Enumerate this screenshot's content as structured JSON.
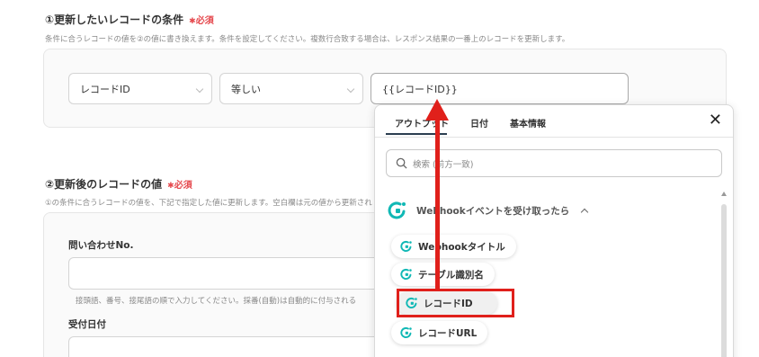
{
  "section1": {
    "title": "①更新したいレコードの条件",
    "required": "必須",
    "description": "条件に合うレコードの値を②の値に書き換えます。条件を設定してください。複数行合致する場合は、レスポンス結果の一番上のレコードを更新します。",
    "condition": {
      "field": "レコードID",
      "operator": "等しい",
      "value": "{{レコードID}}"
    }
  },
  "section2": {
    "title": "②更新後のレコードの値",
    "required": "必須",
    "description": "①の条件に合うレコードの値を、下記で指定した値に更新します。空白欄は元の値から更新され",
    "fields": [
      {
        "label": "問い合わせNo.",
        "hint": "接頭語、番号、接尾語の順で入力してください。採番(自動)は自動的に付与される"
      },
      {
        "label": "受付日付"
      }
    ]
  },
  "popup": {
    "tabs": [
      "アウトプット",
      "日付",
      "基本情報"
    ],
    "active_tab": "アウトプット",
    "close": "✕",
    "search_placeholder": "検索 (前方一致)",
    "group": {
      "label": "Webhookイベントを受け取ったら",
      "items": [
        "Webhookタイトル",
        "テーブル識別名",
        "レコードID",
        "レコードURL"
      ],
      "highlighted": "レコードID"
    }
  },
  "colors": {
    "annotation": "#e0201b",
    "required": "#e5484d",
    "brand_icon": "#10b8b5"
  }
}
